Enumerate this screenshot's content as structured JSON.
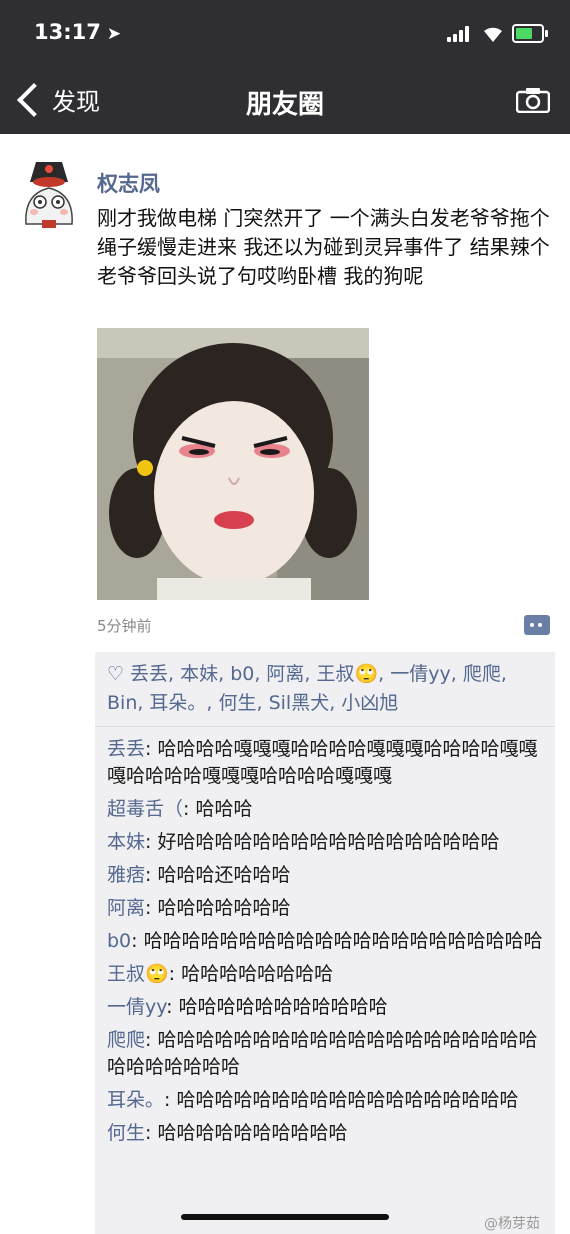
{
  "status_bar": {
    "time": "13:17",
    "location_arrow": "➤"
  },
  "nav": {
    "back_label": "发现",
    "title": "朋友圈",
    "camera_icon": "camera-icon"
  },
  "post": {
    "author": "权志凤",
    "text": "刚才我做电梯 门突然开了 一个满头白发老爷爷拖个绳子缓慢走进来 我还以为碰到灵异事件了 结果辣个老爷爷回头说了句哎哟卧槽 我的狗呢",
    "time_ago": "5分钟前"
  },
  "likes": {
    "heart_icon": "♡",
    "names": "丢丢, 本妹, b0, 阿离, 王叔🙄, 一倩yy, 爬爬, Bin, 耳朵。, 何生, Sil黑犬, 小凶旭"
  },
  "comments": [
    {
      "name": "丢丢",
      "sep": ": ",
      "text": "哈哈哈哈嘎嘎嘎哈哈哈哈嘎嘎嘎哈哈哈哈嘎嘎嘎哈哈哈哈嘎嘎嘎哈哈哈哈嘎嘎嘎"
    },
    {
      "name": "超毒舌（",
      "sep": ": ",
      "text": "哈哈哈"
    },
    {
      "name": "本妹",
      "sep": ": ",
      "text": "好哈哈哈哈哈哈哈哈哈哈哈哈哈哈哈哈哈"
    },
    {
      "name": "雅痞",
      "sep": ": ",
      "text": "哈哈哈还哈哈哈"
    },
    {
      "name": "阿离",
      "sep": ": ",
      "text": "哈哈哈哈哈哈哈"
    },
    {
      "name": "b0",
      "sep": ": ",
      "text": "哈哈哈哈哈哈哈哈哈哈哈哈哈哈哈哈哈哈哈哈哈"
    },
    {
      "name": "王叔🙄",
      "sep": ": ",
      "text": "哈哈哈哈哈哈哈哈"
    },
    {
      "name": "一倩yy",
      "sep": ": ",
      "text": "哈哈哈哈哈哈哈哈哈哈哈"
    },
    {
      "name": "爬爬",
      "sep": ": ",
      "text": "哈哈哈哈哈哈哈哈哈哈哈哈哈哈哈哈哈哈哈哈哈哈哈哈哈哈哈"
    },
    {
      "name": "耳朵。",
      "sep": ": ",
      "text": "哈哈哈哈哈哈哈哈哈哈哈哈哈哈哈哈哈哈"
    },
    {
      "name": "何生",
      "sep": ": ",
      "text": "哈哈哈哈哈哈哈哈哈哈"
    }
  ],
  "watermark_corner": "@杨芽茹"
}
